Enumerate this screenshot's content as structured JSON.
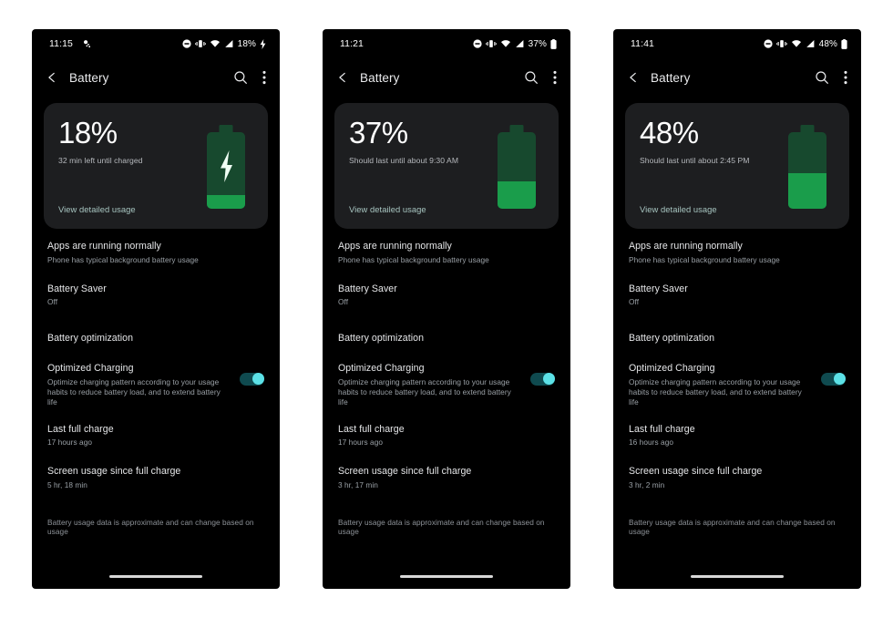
{
  "page": {
    "background_color": "#ffffff",
    "screen_background": "#000000",
    "card_background": "#1d1e20",
    "accent_green": "#1a9d4b",
    "accent_green_dark": "#17492e",
    "toggle_track_color": "#0f4a4f",
    "toggle_knob_color": "#5ce1e6",
    "link_color": "#a7c5c0"
  },
  "common": {
    "appbar": {
      "title": "Battery",
      "back_icon": "chevron-left-icon",
      "search_icon": "search-icon",
      "overflow_icon": "more-vertical-icon"
    },
    "card": {
      "link_label": "View detailed usage",
      "battery_icon": "battery-icon"
    },
    "rows": {
      "apps_title": "Apps are running normally",
      "apps_sub": "Phone has typical background battery usage",
      "saver_title": "Battery Saver",
      "saver_value": "Off",
      "optimization_title": "Battery optimization",
      "optimized_charging_title": "Optimized Charging",
      "optimized_charging_sub": "Optimize charging pattern according to your usage habits to reduce battery load, and to extend battery life",
      "optimized_charging_state": "on",
      "last_full_charge_title": "Last full charge",
      "screen_usage_title": "Screen usage since full charge",
      "footnote": "Battery usage data is approximate and can change based on usage"
    },
    "status_icons": {
      "dnd": "do-not-disturb-icon",
      "vibrate": "vibrate-icon",
      "wifi": "wifi-icon",
      "signal": "cell-signal-icon",
      "battery": "battery-status-icon",
      "charging_bolt": "charging-bolt-icon",
      "location": "location-indicator-icon"
    },
    "navpill": "home-gesture-pill"
  },
  "phones": [
    {
      "id": "phone-1",
      "status": {
        "clock": "11:15",
        "battery_percent": "18%",
        "show_location_icon": true,
        "show_charging_bolt": true
      },
      "card": {
        "percent": "18%",
        "subtitle": "32 min left until charged",
        "fill_level": 18,
        "charging": true
      },
      "last_full_charge_value": "17 hours ago",
      "screen_usage_value": "5 hr, 18 min"
    },
    {
      "id": "phone-2",
      "status": {
        "clock": "11:21",
        "battery_percent": "37%",
        "show_location_icon": false,
        "show_charging_bolt": false
      },
      "card": {
        "percent": "37%",
        "subtitle": "Should last until about 9:30 AM",
        "fill_level": 37,
        "charging": false
      },
      "last_full_charge_value": "17 hours ago",
      "screen_usage_value": "3 hr, 17 min"
    },
    {
      "id": "phone-3",
      "status": {
        "clock": "11:41",
        "battery_percent": "48%",
        "show_location_icon": false,
        "show_charging_bolt": false
      },
      "card": {
        "percent": "48%",
        "subtitle": "Should last until about 2:45 PM",
        "fill_level": 48,
        "charging": false
      },
      "last_full_charge_value": "16 hours ago",
      "screen_usage_value": "3 hr, 2 min"
    }
  ]
}
